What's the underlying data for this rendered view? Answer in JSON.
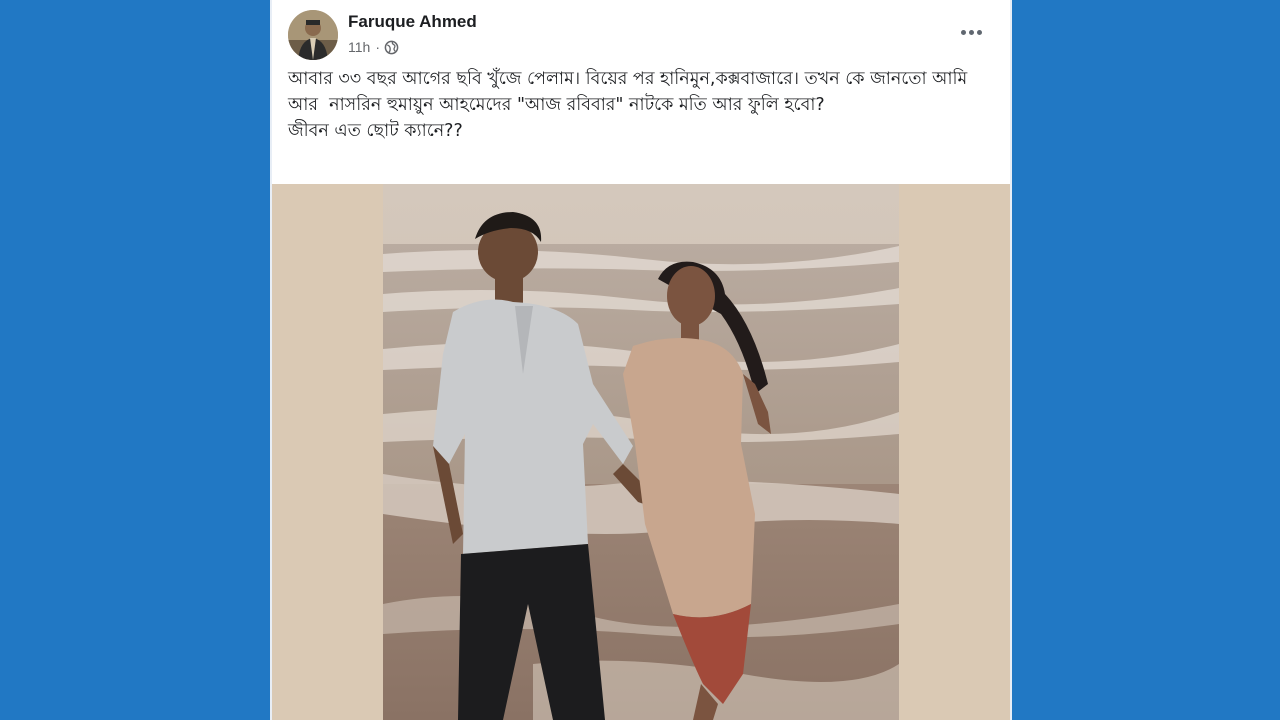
{
  "colors": {
    "page_background": "#2178c4",
    "card_background": "#ffffff",
    "author_text": "#1c1e21",
    "meta_text": "#65676b",
    "photo_background": "#dac9b4"
  },
  "post": {
    "author": "Faruque Ahmed",
    "time": "11h",
    "separator": "·",
    "privacy_icon": "globe-icon",
    "more_icon": "more-options-icon",
    "caption_lines": [
      "আবার ৩৩ বছর আগের ছবি খুঁজে পেলাম। বিয়ের পর হানিমুন,কক্সবাজারে। তখন কে জানতো আমি আর  নাসরিন হুমায়ুন আহমেদের \"আজ রবিবার\" নাটকে মতি আর ফুলি হবো?",
      "জীবন এত ছোট ক্যানে??"
    ]
  }
}
